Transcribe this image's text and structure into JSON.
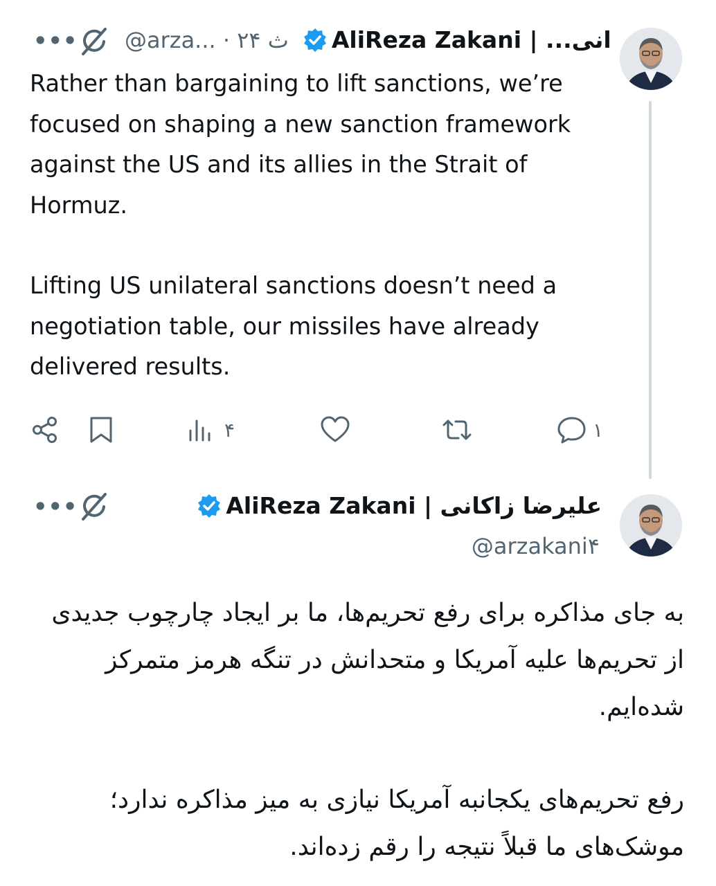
{
  "tweet1": {
    "display_name": "AliReza Zakani | ...انی",
    "handle_time": "@arza... · ۲۴ ث",
    "text_p1": "Rather than bargaining to lift sanctions, we’re focused on shaping a new sanction framework against the US and its allies in the Strait of Hormuz.",
    "text_p2": "Lifting US unilateral sanctions doesn’t need a negotiation table, our missiles have already delivered results.",
    "views": "۴",
    "replies": "۱",
    "more": "•••"
  },
  "tweet2": {
    "display_name": "AliReza Zakani | علیرضا زاکانی",
    "handle": "@arzakani۴",
    "text_p1": "به جای مذاکره برای رفع تحریم‌ها، ما بر ایجاد چارچوب جدیدی از تحریم‌ها علیه آمریکا و متحدانش در تنگه هرمز متمرکز شده‌ایم.",
    "text_p2": "رفع تحریم‌های یکجانبه آمریکا نیازی به میز مذاکره ندارد؛ موشک‌های ما قبلاً نتیجه را رقم زده‌اند.",
    "more": "•••"
  },
  "icons": {
    "verified": "verified-badge-icon",
    "grok": "grok-icon",
    "share": "share-icon",
    "bookmark": "bookmark-icon",
    "views": "analytics-icon",
    "like": "heart-icon",
    "retweet": "retweet-icon",
    "reply": "reply-icon"
  },
  "colors": {
    "verified": "#1d9bf0",
    "text": "#0f1419",
    "secondary": "#536471",
    "thread_line": "#cfd9de"
  }
}
